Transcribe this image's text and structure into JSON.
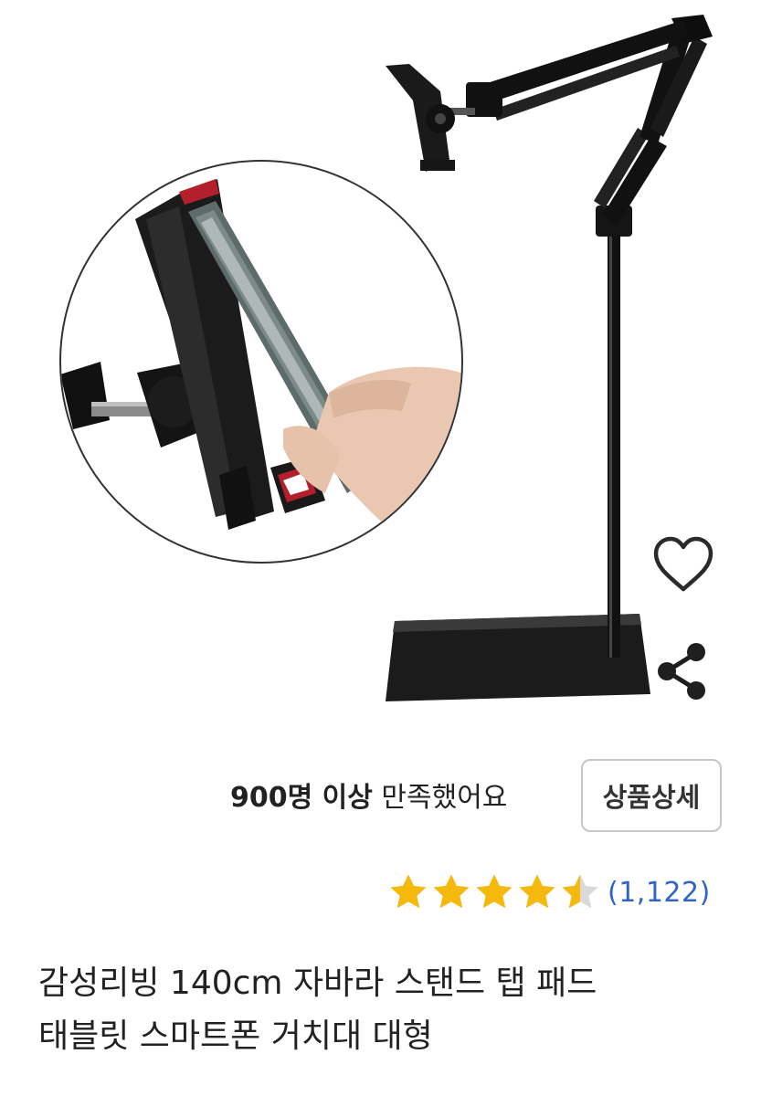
{
  "product": {
    "satisfaction_bold": "900명 이상",
    "satisfaction_rest": " 만족했어요",
    "detail_button_label": "상품상세",
    "rating_value": 4.5,
    "review_count": "(1,122)",
    "title_line1": "감성리빙 140cm 자바라 스탠드 탭 패드",
    "title_line2": "태블릿 스마트폰 거치대 대형"
  },
  "icons": {
    "wishlist": "heart-outline-icon",
    "share": "share-icon",
    "star_full": "star-icon",
    "star_half": "star-half-icon"
  },
  "colors": {
    "star": "#f5b80c",
    "star_empty": "#d9d9d9",
    "review_count": "#2f64c9",
    "text": "#222222"
  }
}
